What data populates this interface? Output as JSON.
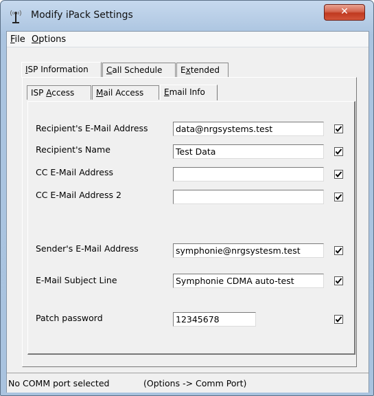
{
  "window": {
    "title": "Modify iPack Settings",
    "close_glyph": "✕"
  },
  "menu": [
    {
      "key": "F",
      "rest": "ile"
    },
    {
      "key": "O",
      "rest": "ptions"
    }
  ],
  "tabs": [
    {
      "pre": "",
      "key": "I",
      "rest": "SP Information",
      "active": true
    },
    {
      "pre": "",
      "key": "C",
      "rest": "all Schedule",
      "active": false
    },
    {
      "pre": "E",
      "key": "x",
      "rest": "tended",
      "active": false
    }
  ],
  "subtabs": [
    {
      "pre": "ISP ",
      "key": "A",
      "rest": "ccess",
      "active": false
    },
    {
      "pre": "",
      "key": "M",
      "rest": "ail Access",
      "active": false
    },
    {
      "pre": "",
      "key": "E",
      "rest": "mail Info",
      "active": true
    }
  ],
  "fields": [
    {
      "label": "Recipient's E-Mail Address",
      "value": "data@nrgsystems.test",
      "checked": true
    },
    {
      "label": "Recipient's Name",
      "value": "Test Data",
      "checked": true
    },
    {
      "label": "CC E-Mail Address",
      "value": "",
      "checked": true
    },
    {
      "label": "CC E-Mail Address 2",
      "value": "",
      "checked": true
    },
    {
      "label": "Sender's E-Mail Address",
      "value": "symphonie@nrgsystesm.test",
      "checked": true
    },
    {
      "label": "E-Mail Subject Line",
      "value": "Symphonie CDMA auto-test",
      "checked": true
    },
    {
      "label": "Patch password",
      "value": "12345678",
      "checked": true
    }
  ],
  "status": {
    "port": "No COMM port selected",
    "hint": "(Options -> Comm Port)"
  }
}
